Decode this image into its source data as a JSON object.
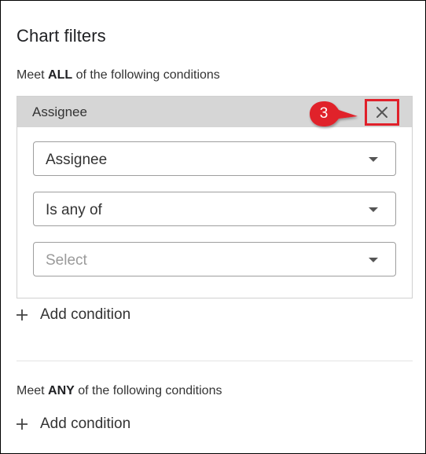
{
  "panel": {
    "title": "Chart filters"
  },
  "all_group": {
    "prefix": "Meet ",
    "keyword": "ALL",
    "suffix": " of the following conditions",
    "condition": {
      "header_label": "Assignee",
      "field_value": "Assignee",
      "operator_value": "Is any of",
      "values_placeholder": "Select"
    },
    "add_label": "Add condition"
  },
  "any_group": {
    "prefix": "Meet ",
    "keyword": "ANY",
    "suffix": " of the following conditions",
    "add_label": "Add condition"
  },
  "callout": {
    "number": "3",
    "color": "#e0202a"
  },
  "icons": [
    "close-icon",
    "chevron-down-icon",
    "plus-icon"
  ]
}
